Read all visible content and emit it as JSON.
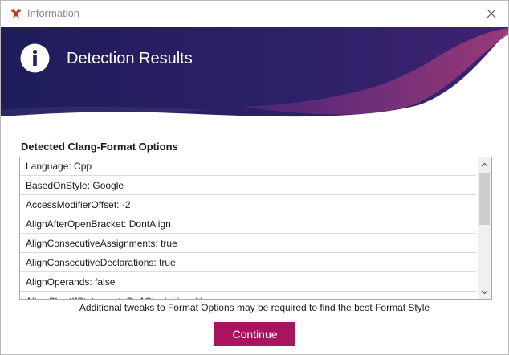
{
  "window": {
    "title": "Information",
    "logo_icon": "app-logo-icon",
    "close_icon": "close-icon"
  },
  "banner": {
    "title": "Detection Results",
    "icon": "info-icon",
    "colors": {
      "dark": "#1f1d5a",
      "mid": "#3a2470",
      "accent": "#6a2a7e",
      "pink": "#9e3a7c"
    }
  },
  "options": {
    "label": "Detected Clang-Format Options",
    "items": [
      "Language: Cpp",
      "BasedOnStyle: Google",
      "AccessModifierOffset: -2",
      "AlignAfterOpenBracket: DontAlign",
      "AlignConsecutiveAssignments: true",
      "AlignConsecutiveDeclarations: true",
      "AlignOperands: false",
      "AllowShortIfStatementsOnASingleLine: No"
    ]
  },
  "note": "Additional tweaks to Format Options may be required to find the best Format Style",
  "continue_label": "Continue",
  "accent_color": "#a8145e"
}
